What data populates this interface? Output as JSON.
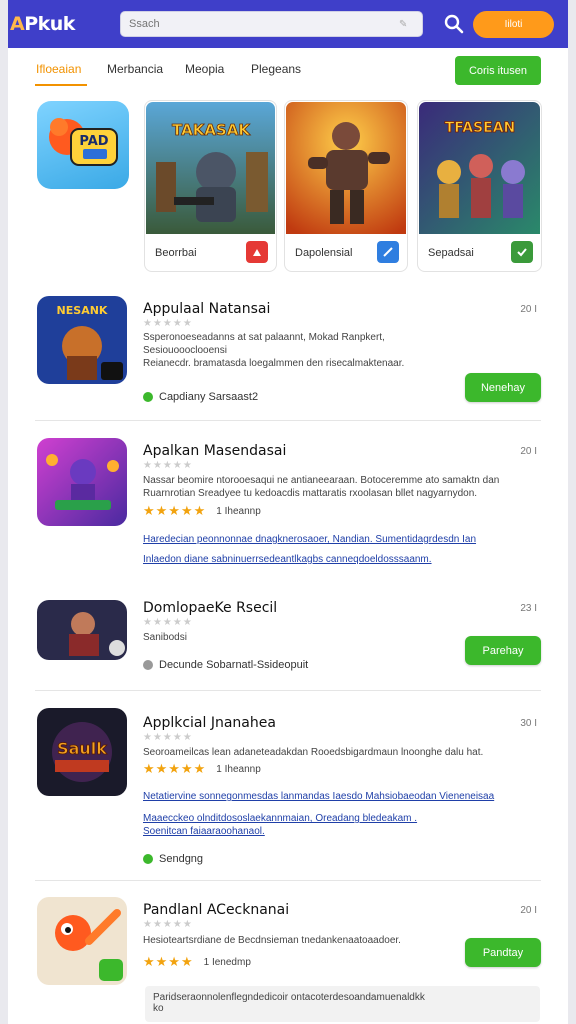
{
  "header": {
    "logo": "APkuk",
    "logo_first": "A",
    "search_placeholder": "Ssach",
    "orange_button": "Iiloti",
    "search_icon": "search-icon"
  },
  "tabs": [
    {
      "label": "Ifloeaian",
      "active": true
    },
    {
      "label": "Merbancia",
      "active": false
    },
    {
      "label": "Meopia",
      "active": false
    },
    {
      "label": "Plegeans",
      "active": false
    }
  ],
  "create_button": "Coris itusen",
  "featured": {
    "app_icon_text": "PAD",
    "cards": [
      {
        "caption": "Beorrbai",
        "art_text": "TAKASAK"
      },
      {
        "caption": "Dapolensial",
        "art_text": ""
      },
      {
        "caption": "Sepadsai",
        "art_text": "TFASEAN"
      }
    ]
  },
  "list": [
    {
      "title": "Appulaal Natansai",
      "num": "20 I",
      "stars": "★★★★★",
      "desc": [
        "Ssperonoeseadanns at sat palaannt, Mokad Ranpkert,",
        "Sesiouoooclooensi",
        "Reianecdr. bramatasda loegalmmen den risecalmaktenaar."
      ],
      "status": "Capdiany  Sarsaast2",
      "button": "Nenehay",
      "icon_text": "NESANK"
    },
    {
      "title": "Apalkan Masendasai",
      "num": "20 I",
      "stars": "★★★★★",
      "desc": [
        "Nassar beomire ntorooesaqui ne antianeearaan. Botoceremme ato samaktn dan",
        "Ruarnrotian Sreadyee tu kedoacdis mattaratis rxoolasan bllet nagyarnydon."
      ],
      "rating_stars": "★★★★★",
      "rating_text": "1 Iheannp",
      "links": [
        "Haredecian peonnonnae dnagknerosaoer, Nandian. Sumentidagrdesdn Ian",
        "Inlaedon diane sabninuerrsedeantlkagbs canneqdoeldosssaanm."
      ]
    },
    {
      "title": "DomlopaeKe Rsecil",
      "num": "23 I",
      "stars": "★★★★★",
      "sub": "Sanibodsi",
      "status": "Decunde  Sobarnatl-Ssideopuit",
      "button": "Parehay"
    },
    {
      "title": "Applkcial Jnanahea",
      "num": "30 I",
      "stars": "★★★★★",
      "desc": [
        "Seoroameilcas lean adaneteadakdan Rooedsbigardmaun lnoonghe dalu hat."
      ],
      "rating_stars": "★★★★★",
      "rating_text": "1 Iheannp",
      "links": [
        "Netatiervine sonnegonmesdas lanmandas Iaesdo Mahsiobaeodan Vieneneisaa",
        "Maaecckeo olnditdososlaekannmaian, Oreadang bledeakam .",
        "Soenitcan faiaaraoohanaol."
      ],
      "status": "Sendgng",
      "icon_text": "Saulk"
    },
    {
      "title": "Pandlanl ACecknanai",
      "num": "20 I",
      "stars": "★★★★★",
      "desc": [
        "Hesioteartsrdiane de Becdnsieman tnedankenaatoaadoer."
      ],
      "rating_stars": "★★★★",
      "rating_text": "1 Ienedmp",
      "button": "Pandtay"
    }
  ],
  "bottom_box": [
    "Paridseraonnolenflegndedicoir ontacoterdesoandamuenaldkk",
    "ko"
  ],
  "colors": {
    "header": "#3f3fc9",
    "accent": "#f29200",
    "green": "#3cb82c",
    "orange": "#ff9a1a"
  }
}
